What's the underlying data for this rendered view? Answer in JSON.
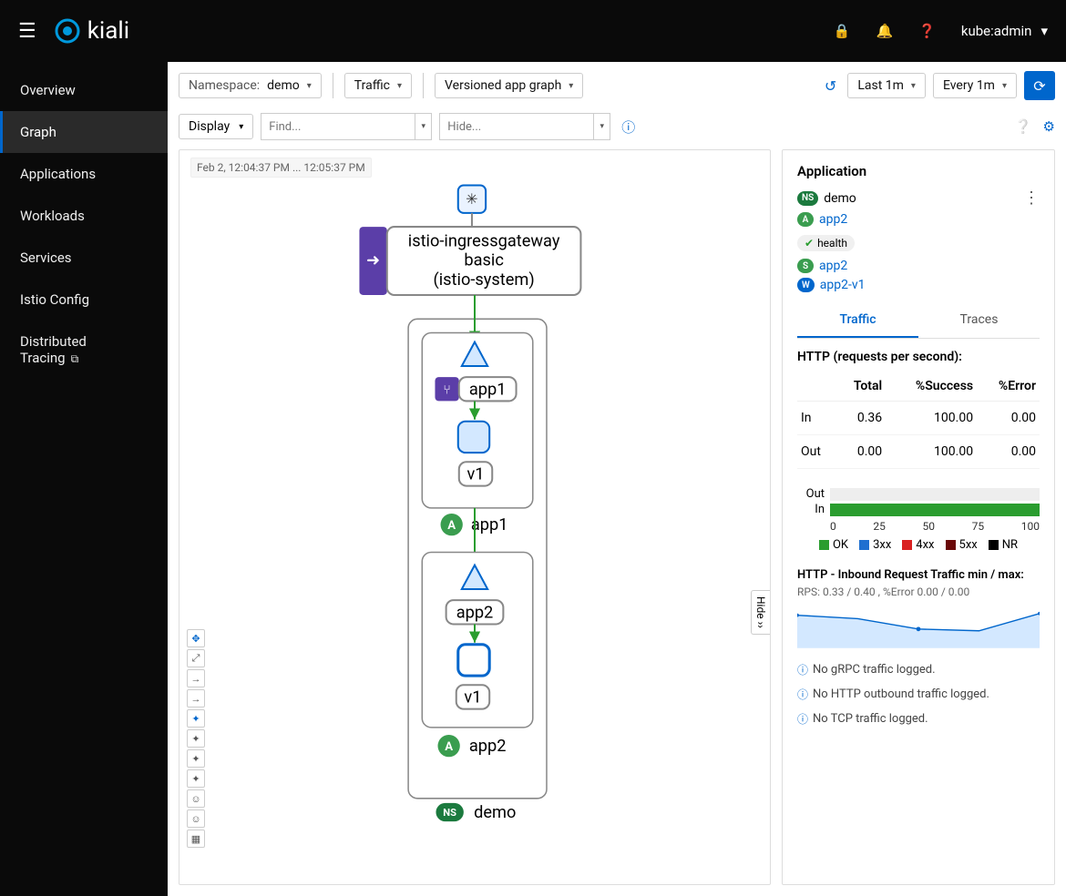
{
  "brand": "kiali",
  "user": "kube:admin",
  "sidebar": {
    "items": [
      {
        "label": "Overview"
      },
      {
        "label": "Graph"
      },
      {
        "label": "Applications"
      },
      {
        "label": "Workloads"
      },
      {
        "label": "Services"
      },
      {
        "label": "Istio Config"
      },
      {
        "label": "Distributed Tracing"
      }
    ]
  },
  "toolbar": {
    "namespace_label": "Namespace:",
    "namespace_value": "demo",
    "edge_label": "Traffic",
    "graph_type": "Versioned app graph",
    "duration": "Last 1m",
    "refresh": "Every 1m"
  },
  "toolbar2": {
    "display": "Display",
    "find_placeholder": "Find...",
    "hide_placeholder": "Hide..."
  },
  "graph": {
    "timestamp": "Feb 2, 12:04:37 PM ... 12:05:37 PM",
    "hide_label": "Hide",
    "root_node": {
      "title": "istio-ingressgateway",
      "sub": "basic",
      "ns": "(istio-system)"
    },
    "appbox1": {
      "svc": "app1",
      "ver": "v1",
      "app": "app1"
    },
    "appbox2": {
      "svc": "app2",
      "ver": "v1",
      "app": "app2"
    },
    "ns_label": "demo"
  },
  "panel": {
    "title": "Application",
    "ns": "demo",
    "app": "app2",
    "health": "health",
    "svc": "app2",
    "wl": "app2-v1",
    "tabs": {
      "traffic": "Traffic",
      "traces": "Traces"
    },
    "http_title": "HTTP (requests per second):",
    "cols": {
      "total": "Total",
      "success": "%Success",
      "error": "%Error"
    },
    "rows": [
      {
        "dir": "In",
        "total": "0.36",
        "success": "100.00",
        "error": "0.00"
      },
      {
        "dir": "Out",
        "total": "0.00",
        "success": "100.00",
        "error": "0.00"
      }
    ],
    "bar_labels": {
      "out": "Out",
      "in": "In"
    },
    "legend": {
      "ok": "OK",
      "xx3": "3xx",
      "xx4": "4xx",
      "xx5": "5xx",
      "nr": "NR"
    },
    "mini_title": "HTTP - Inbound Request Traffic min / max:",
    "mini_sub": "RPS: 0.33 / 0.40 , %Error 0.00 / 0.00",
    "msgs": {
      "grpc": "No gRPC traffic logged.",
      "http_out": "No HTTP outbound traffic logged.",
      "tcp": "No TCP traffic logged."
    }
  },
  "chart_data": {
    "stacked_bar": {
      "type": "bar",
      "title": "Success rate",
      "categories": [
        "Out",
        "In"
      ],
      "series": [
        {
          "name": "OK",
          "values": [
            0,
            100
          ],
          "color": "#2a9d2f"
        },
        {
          "name": "3xx",
          "values": [
            0,
            0
          ],
          "color": "#1f6fd0"
        },
        {
          "name": "4xx",
          "values": [
            0,
            0
          ],
          "color": "#d92020"
        },
        {
          "name": "5xx",
          "values": [
            0,
            0
          ],
          "color": "#6a0808"
        },
        {
          "name": "NR",
          "values": [
            0,
            0
          ],
          "color": "#000000"
        }
      ],
      "xlim": [
        0,
        100
      ],
      "xticks": [
        0,
        25,
        50,
        75,
        100
      ]
    },
    "sparkline": {
      "type": "line",
      "title": "HTTP - Inbound Request Traffic min / max",
      "ylabel": "RPS",
      "ylim": [
        0.3,
        0.45
      ],
      "x": [
        0,
        1,
        2,
        3,
        4
      ],
      "values": [
        0.4,
        0.38,
        0.34,
        0.33,
        0.4
      ],
      "error_values": [
        0.0,
        0.0,
        0.0,
        0.0,
        0.0
      ]
    }
  }
}
